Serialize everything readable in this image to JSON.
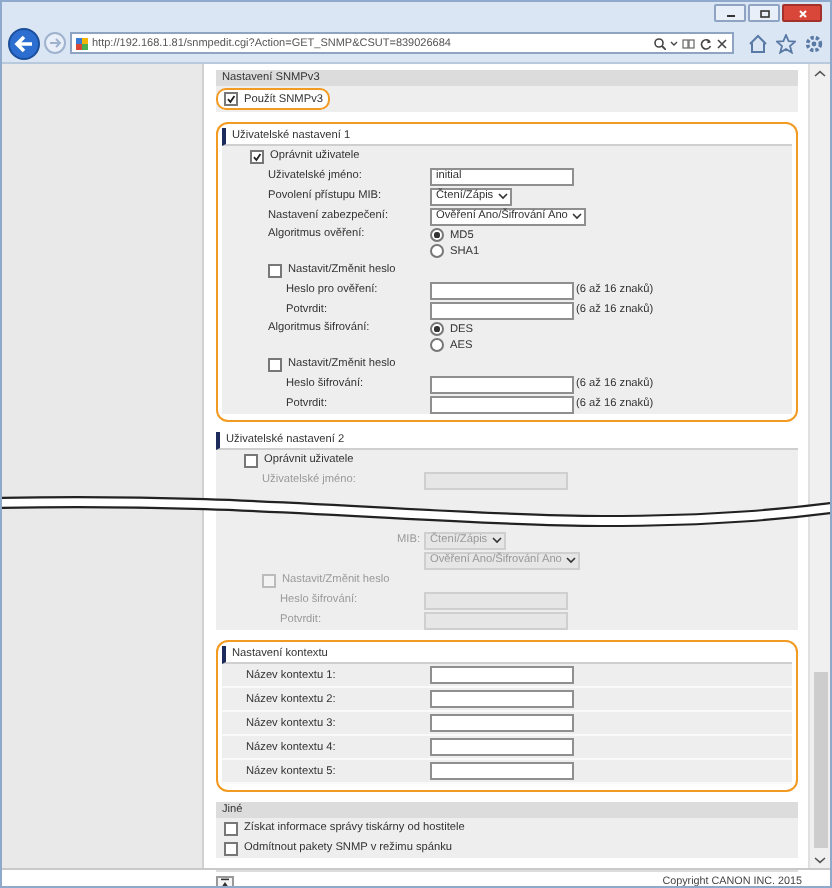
{
  "browser": {
    "url": "http://192.168.1.81/snmpedit.cgi?Action=GET_SNMP&CSUT=839026684"
  },
  "sections": [
    {
      "kind": "plain",
      "title": "Nastavení SNMPv3",
      "disabled": false,
      "highlighted": false,
      "rows": [
        {
          "kind": "checkbox",
          "label": "Použít SNMPv3",
          "checked": true,
          "highlighted": true
        }
      ]
    },
    {
      "kind": "group",
      "title": "Uživatelské nastavení 1",
      "disabled": false,
      "highlighted": true,
      "rows": [
        {
          "kind": "checkbox",
          "label": "Oprávnit uživatele",
          "checked": true,
          "highlighted": false,
          "children": [
            {
              "kind": "field",
              "label": "Uživatelské jméno:",
              "value": "initial"
            },
            {
              "kind": "select",
              "label": "Povolení přístupu MIB:",
              "value": "Čtení/Zápis"
            },
            {
              "kind": "select",
              "label": "Nastavení zabezpečení:",
              "value": "Ověření Ano/Šifrování Ano"
            },
            {
              "kind": "radio",
              "label": "Algoritmus ověření:",
              "options": [
                {
                  "label": "MD5",
                  "selected": true
                },
                {
                  "label": "SHA1",
                  "selected": false
                }
              ]
            },
            {
              "kind": "checkbox",
              "label": "Nastavit/Změnit heslo",
              "checked": false,
              "highlighted": false,
              "children": [
                {
                  "kind": "field",
                  "label": "Heslo pro ověření:",
                  "hint": "(6 až 16 znaků)"
                },
                {
                  "kind": "field",
                  "label": "Potvrdit:",
                  "hint": "(6 až 16 znaků)"
                }
              ]
            },
            {
              "kind": "radio",
              "label": "Algoritmus šifrování:",
              "options": [
                {
                  "label": "DES",
                  "selected": true
                },
                {
                  "label": "AES",
                  "selected": false
                }
              ]
            },
            {
              "kind": "checkbox",
              "label": "Nastavit/Změnit heslo",
              "checked": false,
              "highlighted": false,
              "children": [
                {
                  "kind": "field",
                  "label": "Heslo šifrování:",
                  "hint": "(6 až 16 znaků)"
                },
                {
                  "kind": "field",
                  "label": "Potvrdit:",
                  "hint": "(6 až 16 znaků)"
                }
              ]
            }
          ]
        }
      ]
    },
    {
      "kind": "group",
      "title": "Uživatelské nastavení 2",
      "disabled": true,
      "highlighted": false,
      "rows": [
        {
          "kind": "checkbox",
          "label": "Oprávnit uživatele",
          "checked": false,
          "highlighted": false,
          "children": [
            {
              "kind": "field",
              "label": "Uživatelské jméno:"
            },
            {
              "kind": "break"
            },
            {
              "kind": "select",
              "label": "MIB:",
              "value": "Čtení/Zápis"
            },
            {
              "kind": "select",
              "value": "Ověření Ano/Šifrování Ano"
            },
            {
              "kind": "checkbox",
              "label": "Nastavit/Změnit heslo",
              "checked": false,
              "highlighted": false,
              "children": [
                {
                  "kind": "field",
                  "label": "Heslo šifrování:"
                },
                {
                  "kind": "field",
                  "label": "Potvrdit:"
                }
              ]
            }
          ]
        }
      ]
    },
    {
      "kind": "list",
      "title": "Nastavení kontextu",
      "disabled": false,
      "highlighted": true,
      "rows": [
        {
          "kind": "field",
          "label": "Název kontextu 1:"
        },
        {
          "kind": "field",
          "label": "Název kontextu 2:"
        },
        {
          "kind": "field",
          "label": "Název kontextu 3:"
        },
        {
          "kind": "field",
          "label": "Název kontextu 4:"
        },
        {
          "kind": "field",
          "label": "Název kontextu 5:"
        }
      ]
    },
    {
      "kind": "plain",
      "title": "Jiné",
      "disabled": false,
      "highlighted": false,
      "rows": [
        {
          "kind": "checkbox",
          "label": "Získat informace správy tiskárny od hostitele",
          "checked": false,
          "highlighted": false
        },
        {
          "kind": "checkbox",
          "label": "Odmítnout pakety SNMP v režimu spánku",
          "checked": false,
          "highlighted": false
        }
      ]
    }
  ],
  "footer": {
    "copyright": "Copyright CANON INC. 2015"
  }
}
